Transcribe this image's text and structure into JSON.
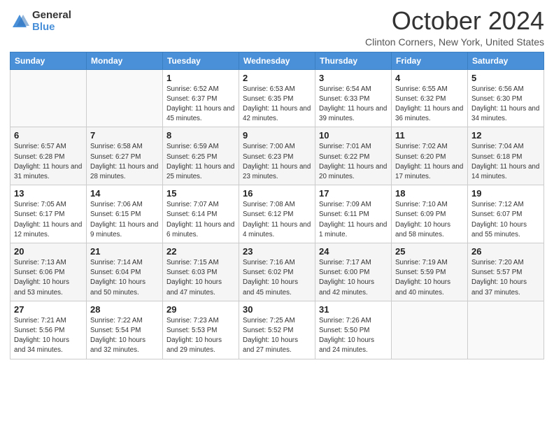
{
  "logo": {
    "general": "General",
    "blue": "Blue"
  },
  "title": "October 2024",
  "location": "Clinton Corners, New York, United States",
  "days_of_week": [
    "Sunday",
    "Monday",
    "Tuesday",
    "Wednesday",
    "Thursday",
    "Friday",
    "Saturday"
  ],
  "weeks": [
    [
      {
        "day": "",
        "info": ""
      },
      {
        "day": "",
        "info": ""
      },
      {
        "day": "1",
        "info": "Sunrise: 6:52 AM\nSunset: 6:37 PM\nDaylight: 11 hours and 45 minutes."
      },
      {
        "day": "2",
        "info": "Sunrise: 6:53 AM\nSunset: 6:35 PM\nDaylight: 11 hours and 42 minutes."
      },
      {
        "day": "3",
        "info": "Sunrise: 6:54 AM\nSunset: 6:33 PM\nDaylight: 11 hours and 39 minutes."
      },
      {
        "day": "4",
        "info": "Sunrise: 6:55 AM\nSunset: 6:32 PM\nDaylight: 11 hours and 36 minutes."
      },
      {
        "day": "5",
        "info": "Sunrise: 6:56 AM\nSunset: 6:30 PM\nDaylight: 11 hours and 34 minutes."
      }
    ],
    [
      {
        "day": "6",
        "info": "Sunrise: 6:57 AM\nSunset: 6:28 PM\nDaylight: 11 hours and 31 minutes."
      },
      {
        "day": "7",
        "info": "Sunrise: 6:58 AM\nSunset: 6:27 PM\nDaylight: 11 hours and 28 minutes."
      },
      {
        "day": "8",
        "info": "Sunrise: 6:59 AM\nSunset: 6:25 PM\nDaylight: 11 hours and 25 minutes."
      },
      {
        "day": "9",
        "info": "Sunrise: 7:00 AM\nSunset: 6:23 PM\nDaylight: 11 hours and 23 minutes."
      },
      {
        "day": "10",
        "info": "Sunrise: 7:01 AM\nSunset: 6:22 PM\nDaylight: 11 hours and 20 minutes."
      },
      {
        "day": "11",
        "info": "Sunrise: 7:02 AM\nSunset: 6:20 PM\nDaylight: 11 hours and 17 minutes."
      },
      {
        "day": "12",
        "info": "Sunrise: 7:04 AM\nSunset: 6:18 PM\nDaylight: 11 hours and 14 minutes."
      }
    ],
    [
      {
        "day": "13",
        "info": "Sunrise: 7:05 AM\nSunset: 6:17 PM\nDaylight: 11 hours and 12 minutes."
      },
      {
        "day": "14",
        "info": "Sunrise: 7:06 AM\nSunset: 6:15 PM\nDaylight: 11 hours and 9 minutes."
      },
      {
        "day": "15",
        "info": "Sunrise: 7:07 AM\nSunset: 6:14 PM\nDaylight: 11 hours and 6 minutes."
      },
      {
        "day": "16",
        "info": "Sunrise: 7:08 AM\nSunset: 6:12 PM\nDaylight: 11 hours and 4 minutes."
      },
      {
        "day": "17",
        "info": "Sunrise: 7:09 AM\nSunset: 6:11 PM\nDaylight: 11 hours and 1 minute."
      },
      {
        "day": "18",
        "info": "Sunrise: 7:10 AM\nSunset: 6:09 PM\nDaylight: 10 hours and 58 minutes."
      },
      {
        "day": "19",
        "info": "Sunrise: 7:12 AM\nSunset: 6:07 PM\nDaylight: 10 hours and 55 minutes."
      }
    ],
    [
      {
        "day": "20",
        "info": "Sunrise: 7:13 AM\nSunset: 6:06 PM\nDaylight: 10 hours and 53 minutes."
      },
      {
        "day": "21",
        "info": "Sunrise: 7:14 AM\nSunset: 6:04 PM\nDaylight: 10 hours and 50 minutes."
      },
      {
        "day": "22",
        "info": "Sunrise: 7:15 AM\nSunset: 6:03 PM\nDaylight: 10 hours and 47 minutes."
      },
      {
        "day": "23",
        "info": "Sunrise: 7:16 AM\nSunset: 6:02 PM\nDaylight: 10 hours and 45 minutes."
      },
      {
        "day": "24",
        "info": "Sunrise: 7:17 AM\nSunset: 6:00 PM\nDaylight: 10 hours and 42 minutes."
      },
      {
        "day": "25",
        "info": "Sunrise: 7:19 AM\nSunset: 5:59 PM\nDaylight: 10 hours and 40 minutes."
      },
      {
        "day": "26",
        "info": "Sunrise: 7:20 AM\nSunset: 5:57 PM\nDaylight: 10 hours and 37 minutes."
      }
    ],
    [
      {
        "day": "27",
        "info": "Sunrise: 7:21 AM\nSunset: 5:56 PM\nDaylight: 10 hours and 34 minutes."
      },
      {
        "day": "28",
        "info": "Sunrise: 7:22 AM\nSunset: 5:54 PM\nDaylight: 10 hours and 32 minutes."
      },
      {
        "day": "29",
        "info": "Sunrise: 7:23 AM\nSunset: 5:53 PM\nDaylight: 10 hours and 29 minutes."
      },
      {
        "day": "30",
        "info": "Sunrise: 7:25 AM\nSunset: 5:52 PM\nDaylight: 10 hours and 27 minutes."
      },
      {
        "day": "31",
        "info": "Sunrise: 7:26 AM\nSunset: 5:50 PM\nDaylight: 10 hours and 24 minutes."
      },
      {
        "day": "",
        "info": ""
      },
      {
        "day": "",
        "info": ""
      }
    ]
  ]
}
